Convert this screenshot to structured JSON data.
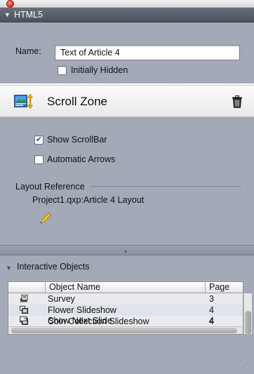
{
  "palette": {
    "section_header_bg": "#5a5f6b",
    "panel_bg": "#a3a9b6",
    "close_button": "#e0322a"
  },
  "section": {
    "title": "HTML5"
  },
  "name_field": {
    "label": "Name:",
    "value": "Text of Article 4"
  },
  "initially_hidden": {
    "label": "Initially Hidden",
    "checked": false
  },
  "scroll_zone": {
    "title": "Scroll Zone",
    "icon": "scroll-zone-icon",
    "delete_icon": "trash-icon",
    "show_scrollbar": {
      "label": "Show ScrollBar",
      "checked": true
    },
    "automatic_arrows": {
      "label": "Automatic Arrows",
      "checked": false
    }
  },
  "layout_reference": {
    "label": "Layout Reference",
    "value": "Project1.qxp:Article 4 Layout",
    "edit_icon": "pencil-icon"
  },
  "interactive_objects": {
    "title": "Interactive Objects",
    "columns": {
      "name": "Object Name",
      "page": "Page"
    },
    "rows": [
      {
        "icon": "survey-icon",
        "name": "Survey",
        "page": "3"
      },
      {
        "icon": "slideshow-icon",
        "name": "Flower Slideshow",
        "page": "4"
      },
      {
        "icon": "slideshow-icon",
        "name": "Coin Collection Slideshow",
        "page": "4"
      },
      {
        "icon": "show-slide-action-icon",
        "name": "Show Next Slide",
        "page": "4"
      }
    ]
  }
}
